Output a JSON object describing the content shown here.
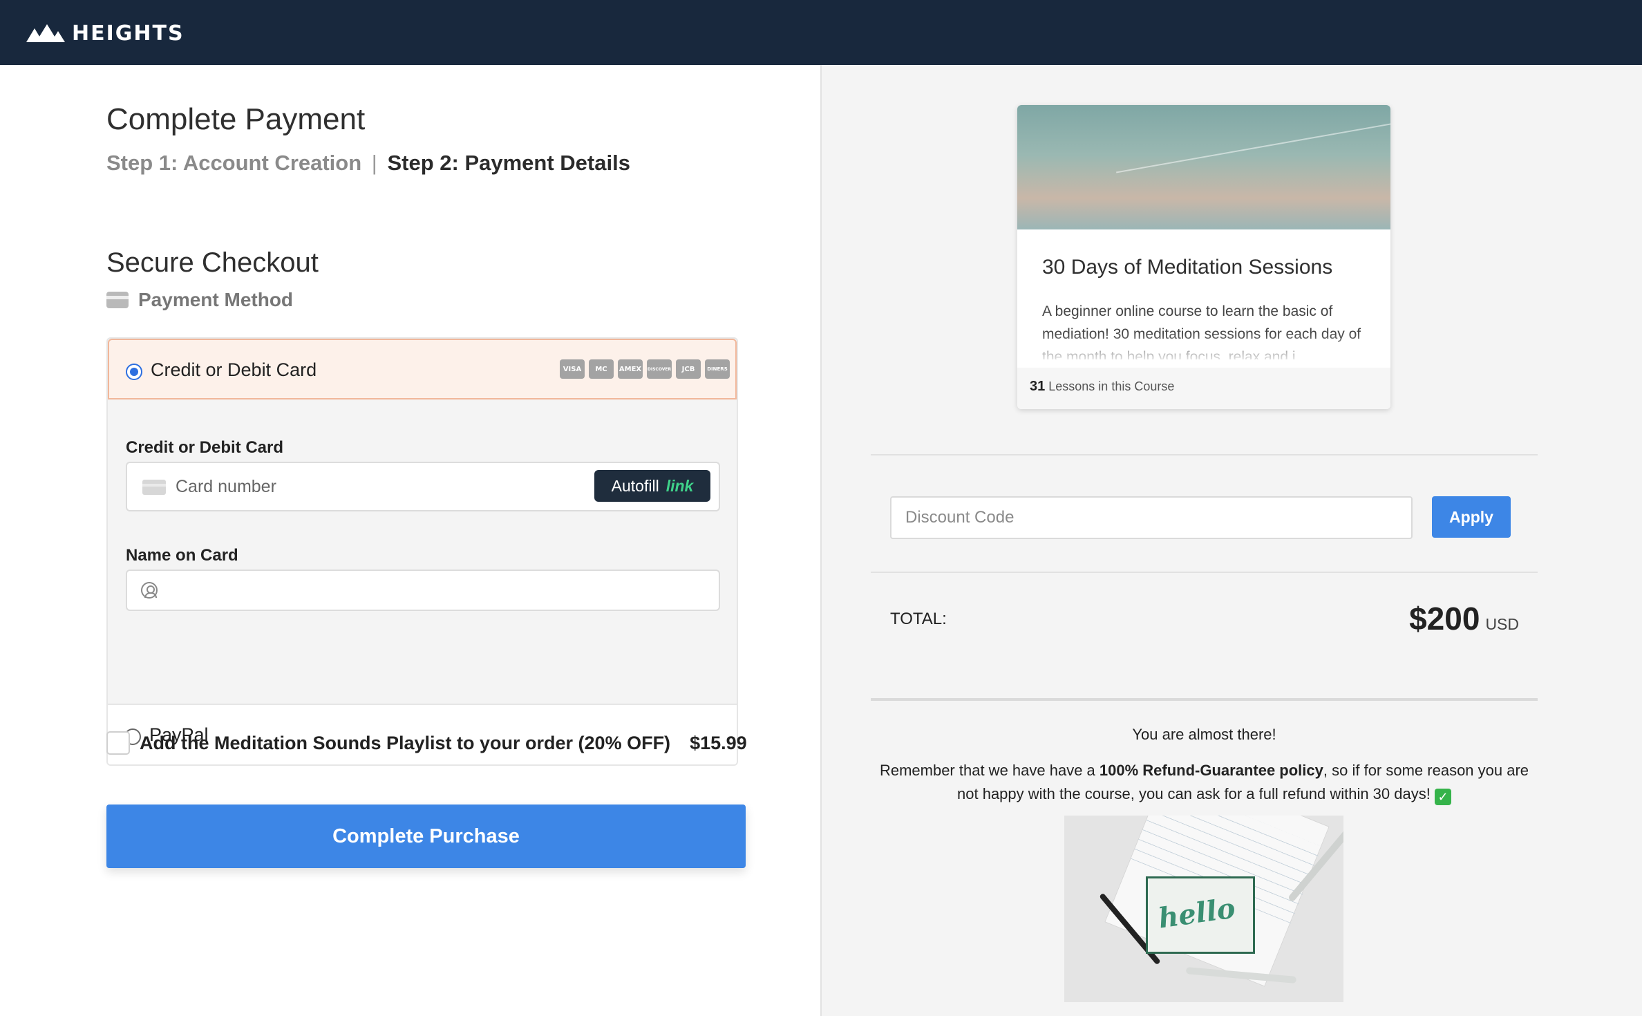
{
  "brand": {
    "name": "HEIGHTS"
  },
  "checkout": {
    "page_title": "Complete Payment",
    "step1": "Step 1: Account Creation",
    "step_separator": "|",
    "step2": "Step 2: Payment Details",
    "secure_title": "Secure Checkout",
    "payment_method_label": "Payment Method",
    "card_option_label": "Credit or Debit Card",
    "card_brands": [
      "VISA",
      "MC",
      "AMEX",
      "DISCOVER",
      "JCB",
      "DINERS"
    ],
    "card_field_label": "Credit or Debit Card",
    "card_number_placeholder": "Card number",
    "autofill_label": "Autofill",
    "autofill_link": "link",
    "name_field_label": "Name on Card",
    "name_value": "",
    "paypal_label": "PayPal",
    "selected_method": "card",
    "addon_label": "Add the Meditation Sounds Playlist to your order (20% OFF)",
    "addon_price": "$15.99",
    "addon_checked": false,
    "purchase_label": "Complete Purchase"
  },
  "course": {
    "title": "30 Days of Meditation Sessions",
    "description": "A beginner online course to learn the basic of mediation! 30 meditation sessions for each day of the month to help you focus, relax and i...",
    "lessons_count": "31",
    "lessons_label": "Lessons in this Course"
  },
  "summary": {
    "discount_placeholder": "Discount Code",
    "apply_label": "Apply",
    "total_label": "TOTAL:",
    "total_amount": "$200",
    "currency": "USD",
    "almost_there": "You are almost there!",
    "remember_prefix": "Remember that we have have a ",
    "policy": "100% Refund-Guarantee policy",
    "remember_suffix": ", so if for some reason you are not happy with the course, you can ask for a full refund within 30 days!",
    "check_emoji": "✓",
    "image_text": "hello"
  },
  "colors": {
    "topbar": "#18283d",
    "primary": "#3d86e6",
    "selected_bg": "#fdf1ea",
    "selected_border": "#f1b79a"
  }
}
